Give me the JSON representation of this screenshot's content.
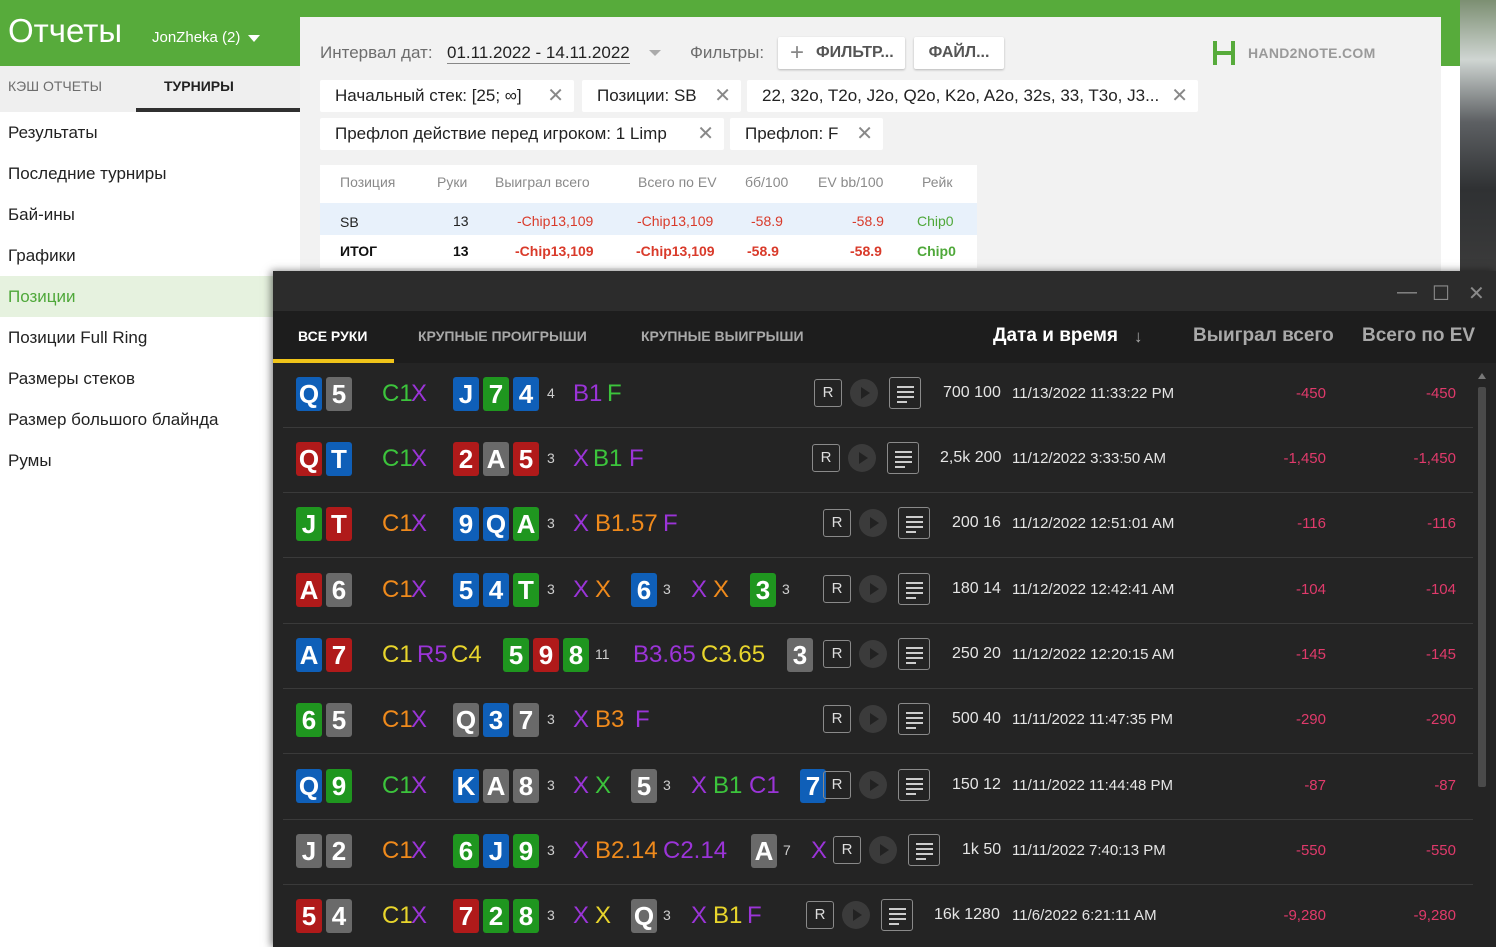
{
  "app": {
    "title": "Отчеты",
    "player": "JonZheka (2)"
  },
  "left_tabs": [
    "КЭШ ОТЧЕТЫ",
    "ТУРНИРЫ"
  ],
  "nav": [
    "Результаты",
    "Последние турниры",
    "Бай-ины",
    "Графики",
    "Позиции",
    "Позиции Full Ring",
    "Размеры стеков",
    "Размер большого блайнда",
    "Румы"
  ],
  "filters": {
    "date_label": "Интервал дат:",
    "date_value": "01.11.2022 - 14.11.2022",
    "filters_label": "Фильтры:",
    "filter_button": "ФИЛЬТР...",
    "file_button": "ФАЙЛ...",
    "logo_text": "HAND2NOTE.COM",
    "chips": [
      "Начальный стек: [25; ∞]",
      "Позиции: SB",
      "22, 32o, T2o, J2o, Q2o, K2o, A2o, 32s, 33, T3o, J3...",
      "Префлоп действие перед игроком: 1 Limp",
      "Префлоп: F"
    ]
  },
  "report": {
    "headers": [
      "Позиция",
      "Руки",
      "Выиграл всего",
      "Всего по EV",
      "бб/100",
      "EV bb/100",
      "Рейк"
    ],
    "rows": [
      [
        "SB",
        "13",
        "-Chip13,109",
        "-Chip13,109",
        "-58.9",
        "-58.9",
        "Chip0"
      ],
      [
        "ИТОГ",
        "13",
        "-Chip13,109",
        "-Chip13,109",
        "-58.9",
        "-58.9",
        "Chip0"
      ]
    ]
  },
  "hands_window": {
    "tabs": [
      "ВСЕ РУКИ",
      "КРУПНЫЕ ПРОИГРЫШИ",
      "КРУПНЫЕ ВЫИГРЫШИ"
    ],
    "columns": [
      "Дата и время",
      "↓",
      "Выиграл всего",
      "Всего по EV"
    ],
    "controls": {
      "minimize": "—",
      "maximize": "☐",
      "close": "✕"
    },
    "btn_r": "R",
    "colors": {
      "spade": "#6a6a6a",
      "heart": "#b01a1a",
      "diamond": "#0f5fb8",
      "club": "#1f961f",
      "purple": "#9b34d8",
      "green_act": "#3cc43c",
      "orange": "#ef8a1c",
      "yellow": "#e8d52c",
      "loss": "#e03a6b"
    },
    "hands": [
      {
        "cards": [
          [
            "Q",
            "d"
          ],
          [
            "5",
            "s"
          ]
        ],
        "preflop": [
          [
            "C1",
            "#3cc43c"
          ],
          [
            "X",
            "#9b34d8"
          ]
        ],
        "flop": [
          [
            "J",
            "d"
          ],
          [
            "7",
            "c"
          ],
          [
            "4",
            "d"
          ]
        ],
        "flop_cnt": "4",
        "flop_act": [
          [
            "B1",
            "#9b34d8"
          ],
          [
            "F",
            "#3cc43c"
          ]
        ],
        "stakes": "700 100",
        "date": "11/13/2022 11:33:22 PM",
        "won": "-450",
        "ev": "-450"
      },
      {
        "cards": [
          [
            "Q",
            "h"
          ],
          [
            "T",
            "d"
          ]
        ],
        "preflop": [
          [
            "C1",
            "#3cc43c"
          ],
          [
            "X",
            "#9b34d8"
          ]
        ],
        "flop": [
          [
            "2",
            "h"
          ],
          [
            "A",
            "s"
          ],
          [
            "5",
            "h"
          ]
        ],
        "flop_cnt": "3",
        "flop_act": [
          [
            "X",
            "#9b34d8"
          ],
          [
            "B1",
            "#3cc43c"
          ],
          [
            "F",
            "#9b34d8"
          ]
        ],
        "stakes": "2,5k 200",
        "date": "11/12/2022 3:33:50 AM",
        "won": "-1,450",
        "ev": "-1,450"
      },
      {
        "cards": [
          [
            "J",
            "c"
          ],
          [
            "T",
            "h"
          ]
        ],
        "preflop": [
          [
            "C1",
            "#ef8a1c"
          ],
          [
            "X",
            "#9b34d8"
          ]
        ],
        "flop": [
          [
            "9",
            "d"
          ],
          [
            "Q",
            "d"
          ],
          [
            "A",
            "c"
          ]
        ],
        "flop_cnt": "3",
        "flop_act": [
          [
            "X",
            "#9b34d8"
          ],
          [
            "B1.57",
            "#ef8a1c"
          ],
          [
            "F",
            "#9b34d8"
          ]
        ],
        "stakes": "200 16",
        "date": "11/12/2022 12:51:01 AM",
        "won": "-116",
        "ev": "-116"
      },
      {
        "cards": [
          [
            "A",
            "h"
          ],
          [
            "6",
            "s"
          ]
        ],
        "preflop": [
          [
            "C1",
            "#ef8a1c"
          ],
          [
            "X",
            "#9b34d8"
          ]
        ],
        "flop": [
          [
            "5",
            "d"
          ],
          [
            "4",
            "d"
          ],
          [
            "T",
            "c"
          ]
        ],
        "flop_cnt": "3",
        "flop_act": [
          [
            "X",
            "#9b34d8"
          ],
          [
            "X",
            "#ef8a1c"
          ]
        ],
        "turn": [
          [
            "6",
            "d"
          ]
        ],
        "turn_cnt": "3",
        "turn_act": [
          [
            "X",
            "#9b34d8"
          ],
          [
            "X",
            "#ef8a1c"
          ]
        ],
        "river": [
          [
            "3",
            "c"
          ]
        ],
        "river_cnt": "3",
        "stakes": "180 14",
        "date": "11/12/2022 12:42:41 AM",
        "won": "-104",
        "ev": "-104"
      },
      {
        "cards": [
          [
            "A",
            "d"
          ],
          [
            "7",
            "h"
          ]
        ],
        "preflop": [
          [
            "C1",
            "#e8d52c"
          ],
          [
            "R5",
            "#9b34d8"
          ],
          [
            "C4",
            "#e8d52c"
          ]
        ],
        "flop": [
          [
            "5",
            "c"
          ],
          [
            "9",
            "h"
          ],
          [
            "8",
            "c"
          ]
        ],
        "flop_cnt": "11",
        "flop_act": [
          [
            "B3.65",
            "#9b34d8"
          ],
          [
            "C3.65",
            "#e8d52c"
          ]
        ],
        "turn": [
          [
            "3",
            "s"
          ]
        ],
        "stakes": "250 20",
        "date": "11/12/2022 12:20:15 AM",
        "won": "-145",
        "ev": "-145"
      },
      {
        "cards": [
          [
            "6",
            "c"
          ],
          [
            "5",
            "s"
          ]
        ],
        "preflop": [
          [
            "C1",
            "#ef8a1c"
          ],
          [
            "X",
            "#9b34d8"
          ]
        ],
        "flop": [
          [
            "Q",
            "s"
          ],
          [
            "3",
            "d"
          ],
          [
            "7",
            "s"
          ]
        ],
        "flop_cnt": "3",
        "flop_act": [
          [
            "X",
            "#9b34d8"
          ],
          [
            "B3",
            "#ef8a1c"
          ],
          [
            "F",
            "#9b34d8"
          ]
        ],
        "stakes": "500 40",
        "date": "11/11/2022 11:47:35 PM",
        "won": "-290",
        "ev": "-290"
      },
      {
        "cards": [
          [
            "Q",
            "d"
          ],
          [
            "9",
            "c"
          ]
        ],
        "preflop": [
          [
            "C1",
            "#3cc43c"
          ],
          [
            "X",
            "#9b34d8"
          ]
        ],
        "flop": [
          [
            "K",
            "d"
          ],
          [
            "A",
            "s"
          ],
          [
            "8",
            "s"
          ]
        ],
        "flop_cnt": "3",
        "flop_act": [
          [
            "X",
            "#9b34d8"
          ],
          [
            "X",
            "#3cc43c"
          ]
        ],
        "turn": [
          [
            "5",
            "s"
          ]
        ],
        "turn_cnt": "3",
        "turn_act": [
          [
            "X",
            "#9b34d8"
          ],
          [
            "B1",
            "#3cc43c"
          ],
          [
            "C1",
            "#9b34d8"
          ]
        ],
        "river": [
          [
            "7",
            "d"
          ]
        ],
        "stakes": "150 12",
        "date": "11/11/2022 11:44:48 PM",
        "won": "-87",
        "ev": "-87"
      },
      {
        "cards": [
          [
            "J",
            "s"
          ],
          [
            "2",
            "s"
          ]
        ],
        "preflop": [
          [
            "C1",
            "#ef8a1c"
          ],
          [
            "X",
            "#9b34d8"
          ]
        ],
        "flop": [
          [
            "6",
            "c"
          ],
          [
            "J",
            "d"
          ],
          [
            "9",
            "c"
          ]
        ],
        "flop_cnt": "3",
        "flop_act": [
          [
            "X",
            "#9b34d8"
          ],
          [
            "B2.14",
            "#ef8a1c"
          ],
          [
            "C2.14",
            "#9b34d8"
          ]
        ],
        "turn": [
          [
            "A",
            "s"
          ]
        ],
        "turn_cnt": "7",
        "turn_act": [
          [
            "X",
            "#9b34d8"
          ]
        ],
        "stakes": "1k 50",
        "date": "11/11/2022 7:40:13 PM",
        "won": "-550",
        "ev": "-550"
      },
      {
        "cards": [
          [
            "5",
            "h"
          ],
          [
            "4",
            "s"
          ]
        ],
        "preflop": [
          [
            "C1",
            "#e8d52c"
          ],
          [
            "X",
            "#9b34d8"
          ]
        ],
        "flop": [
          [
            "7",
            "h"
          ],
          [
            "2",
            "c"
          ],
          [
            "8",
            "c"
          ]
        ],
        "flop_cnt": "3",
        "flop_act": [
          [
            "X",
            "#9b34d8"
          ],
          [
            "X",
            "#e8d52c"
          ]
        ],
        "turn": [
          [
            "Q",
            "s"
          ]
        ],
        "turn_cnt": "3",
        "turn_act": [
          [
            "X",
            "#9b34d8"
          ],
          [
            "B1",
            "#e8d52c"
          ],
          [
            "F",
            "#9b34d8"
          ]
        ],
        "stakes": "16k 1280",
        "date": "11/6/2022 6:21:11 AM",
        "won": "-9,280",
        "ev": "-9,280"
      }
    ]
  }
}
